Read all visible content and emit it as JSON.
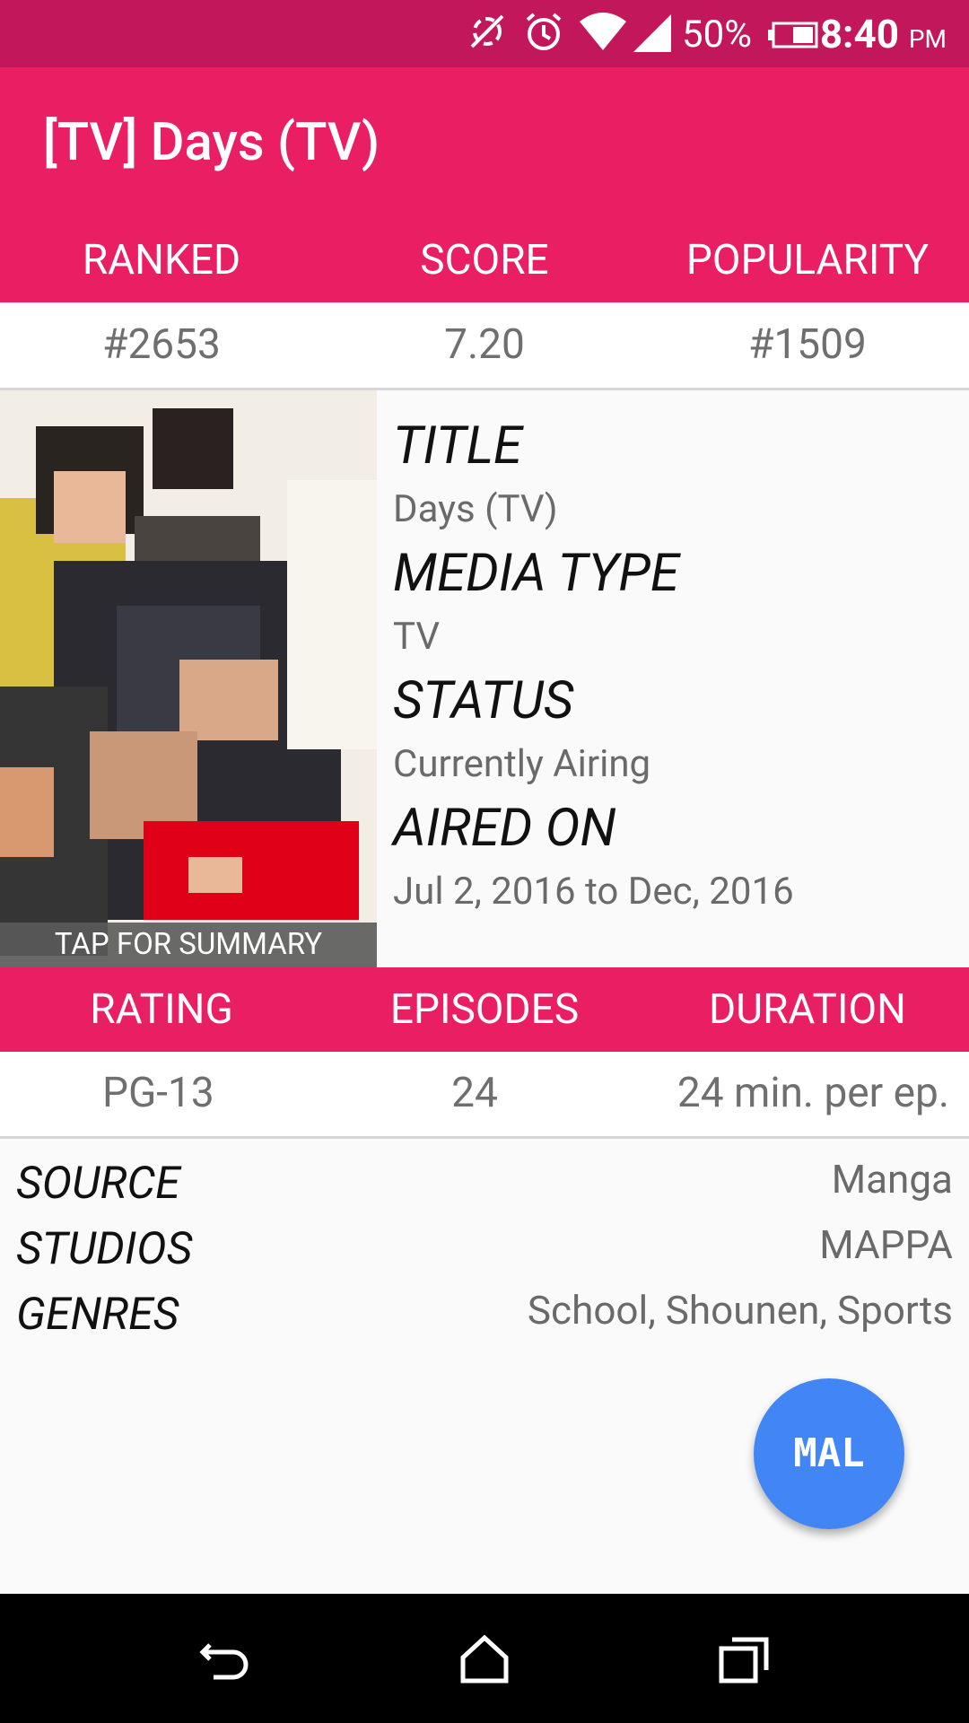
{
  "status_bar": {
    "battery_percent": "50%",
    "time": "8:40",
    "ampm": "PM",
    "icons": [
      "sync-disabled-icon",
      "alarm-icon",
      "wifi-icon",
      "cell-signal-icon",
      "battery-icon"
    ]
  },
  "app_bar": {
    "title": "[TV] Days (TV)"
  },
  "stats_top": {
    "headers": [
      "RANKED",
      "SCORE",
      "POPULARITY"
    ],
    "values": [
      "#2653",
      "7.20",
      "#1509"
    ]
  },
  "poster": {
    "tap_label": "TAP FOR SUMMARY"
  },
  "info": {
    "title_label": "TITLE",
    "title_value": "Days (TV)",
    "media_type_label": "MEDIA TYPE",
    "media_type_value": "TV",
    "status_label": "STATUS",
    "status_value": "Currently Airing",
    "aired_label": "AIRED ON",
    "aired_value": "Jul 2, 2016 to Dec, 2016"
  },
  "stats_bottom": {
    "headers": [
      "RATING",
      "EPISODES",
      "DURATION"
    ],
    "values": [
      "PG-13",
      "24",
      "24 min. per ep."
    ]
  },
  "details": [
    {
      "label": "SOURCE",
      "value": "Manga"
    },
    {
      "label": "STUDIOS",
      "value": "MAPPA"
    },
    {
      "label": "GENRES",
      "value": "School, Shounen, Sports"
    }
  ],
  "fab": {
    "label": "MAL"
  },
  "colors": {
    "primary": "#e91e63",
    "primary_dark": "#c2185b",
    "fab": "#4285f4"
  }
}
